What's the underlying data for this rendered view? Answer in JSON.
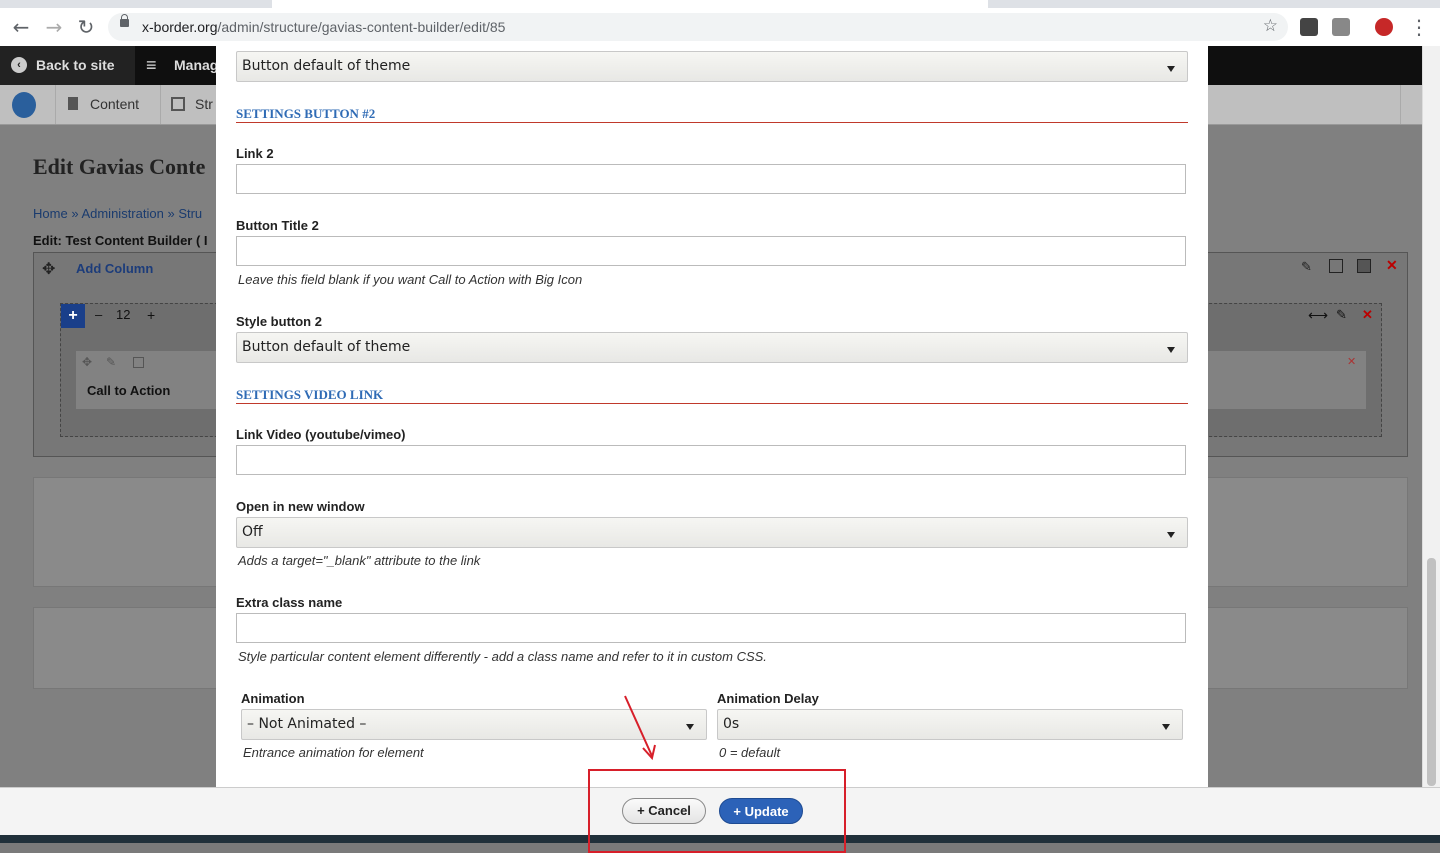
{
  "browser": {
    "url_host": "x-border.org",
    "url_path": "/admin/structure/gavias-content-builder/edit/85"
  },
  "admin_toolbar": {
    "back_to_site": "Back to site",
    "manage": "Manag",
    "content": "Content",
    "structure": "Str"
  },
  "page": {
    "title": "Edit Gavias Conte",
    "breadcrumb": [
      "Home",
      "»",
      "Administration",
      "»",
      "Stru"
    ],
    "edit_line": "Edit: Test Content Builder ( I",
    "add_column": "Add Column",
    "col_size": "12",
    "col_minus": "–",
    "col_plus": "+",
    "element_name": "Call to Action"
  },
  "modal": {
    "style_button_1": {
      "value": "Button default of theme"
    },
    "section_button2": "SETTINGS BUTTON #2",
    "link2": {
      "label": "Link 2",
      "value": ""
    },
    "button_title2": {
      "label": "Button Title 2",
      "value": "",
      "help": "Leave this field blank if you want Call to Action with Big Icon"
    },
    "style_button2": {
      "label": "Style button 2",
      "value": "Button default of theme"
    },
    "section_video": "SETTINGS VIDEO LINK",
    "link_video": {
      "label": "Link Video (youtube/vimeo)",
      "value": ""
    },
    "new_window": {
      "label": "Open in new window",
      "value": "Off",
      "help": "Adds a target=\"_blank\" attribute to the link"
    },
    "extra_class": {
      "label": "Extra class name",
      "value": "",
      "help": "Style particular content element differently - add a class name and refer to it in custom CSS."
    },
    "animation": {
      "label": "Animation",
      "value": "– Not Animated –",
      "help": "Entrance animation for element"
    },
    "animation_delay": {
      "label": "Animation Delay",
      "value": "0s",
      "help": "0 = default"
    }
  },
  "footer": {
    "cancel": "+ Cancel",
    "update": "+ Update"
  },
  "colors": {
    "accent": "#2c62b8",
    "section_underline": "#c0392b",
    "annotation": "#d71f2a"
  }
}
